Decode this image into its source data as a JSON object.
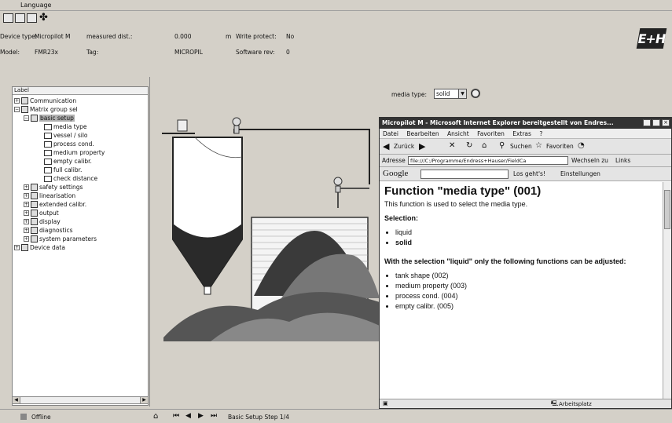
{
  "menubar": {
    "language_label": "Language"
  },
  "header": {
    "device_type_label": "Device type:",
    "device_type_value": "Micropilot M",
    "measured_label": "measured dist.:",
    "measured_value": "0.000",
    "measured_unit": "m",
    "write_protect_label": "Write protect:",
    "write_protect_value": "No",
    "model_label": "Model:",
    "model_value": "FMR23x",
    "tag_label": "Tag:",
    "tag_value": "MICROPIL",
    "software_label": "Software rev:",
    "software_value": "0",
    "logo_text": "E+H"
  },
  "tree": {
    "header": "Label",
    "items": [
      "Communication",
      "Matrix group sel",
      "basic setup",
      "media type",
      "vessel / silo",
      "process cond.",
      "medium property",
      "empty calibr.",
      "full calibr.",
      "check distance",
      "safety settings",
      "linearisation",
      "extended calibr.",
      "output",
      "display",
      "diagnostics",
      "system parameters",
      "Device data"
    ]
  },
  "main": {
    "media_type_label": "media type:",
    "media_type_value": "solid"
  },
  "ie": {
    "title": "Micropilot M - Microsoft Internet Explorer bereitgestellt von Endres...",
    "menu": [
      "Datei",
      "Bearbeiten",
      "Ansicht",
      "Favoriten",
      "Extras",
      "?"
    ],
    "back_label": "Zurück",
    "search_label": "Suchen",
    "favorites_label": "Favoriten",
    "address_label": "Adresse",
    "address_value": "file:///C:/Programme/Endress+Hauser/FieldCa",
    "go_label": "Wechseln zu",
    "links_label": "Links",
    "google_label": "Google",
    "google_go_label": "Los geht's!",
    "google_settings_label": "Einstellungen",
    "heading": "Function \"media type\" (001)",
    "intro": "This function is used to select the media type.",
    "selection_label": "Selection:",
    "options": [
      "liquid",
      "solid"
    ],
    "note": "With the selection \"liquid\" only the following functions can be adjusted:",
    "functions": [
      "tank shape (002)",
      "medium property (003)",
      "process cond. (004)",
      "empty calibr. (005)"
    ],
    "status_zone": "Arbeitsplatz"
  },
  "statusbar": {
    "offline_label": "Offline",
    "step_label": "Basic Setup Step 1/4"
  }
}
